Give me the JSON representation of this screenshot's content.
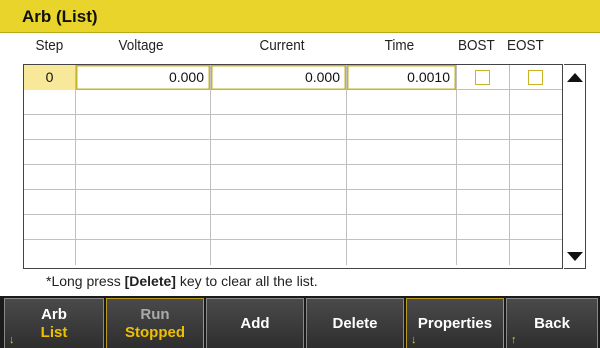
{
  "title": "Arb (List)",
  "columns": {
    "step": "Step",
    "voltage": "Voltage",
    "current": "Current",
    "time": "Time",
    "bost": "BOST",
    "eost": "EOST"
  },
  "rows": [
    {
      "step": "0",
      "voltage": "0.000",
      "current": "0.000",
      "time": "0.0010",
      "bost": false,
      "eost": false
    }
  ],
  "note": {
    "prefix": "*Long press ",
    "key": "[Delete]",
    "suffix": " key to clear all the list."
  },
  "softkeys": [
    {
      "line1": "Arb",
      "line2": "List"
    },
    {
      "line1": "Run",
      "line2": "Stopped"
    },
    {
      "line1": "Add",
      "line2": ""
    },
    {
      "line1": "Delete",
      "line2": ""
    },
    {
      "line1": "Properties",
      "line2": ""
    },
    {
      "line1": "Back",
      "line2": ""
    }
  ],
  "colors": {
    "title_bar": "#e8d42a",
    "accent_text": "#f0c000",
    "highlight_cell": "#f8e89a",
    "softkey_bg": "#3a3a3a"
  }
}
